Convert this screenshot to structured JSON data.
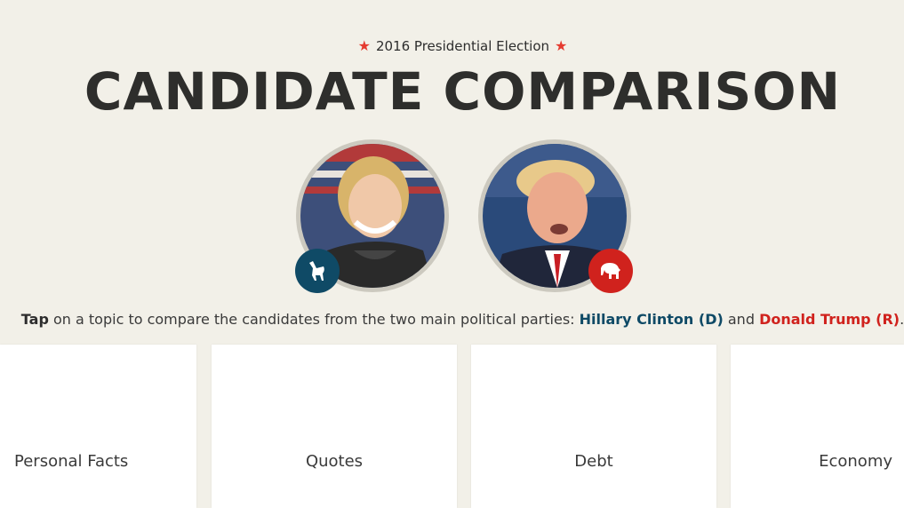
{
  "header": {
    "kicker": "2016 Presidential Election",
    "title": "CANDIDATE COMPARISON"
  },
  "candidates": [
    {
      "name": "Hillary Clinton (D)",
      "party": "Democratic",
      "party_icon": "donkey-icon",
      "color": "#0f4a66"
    },
    {
      "name": "Donald Trump (R)",
      "party": "Republican",
      "party_icon": "elephant-icon",
      "color": "#d0221d"
    }
  ],
  "instructions": {
    "tap": "Tap",
    "middle": " on a topic to compare the candidates from the two main political parties: ",
    "and": " and ",
    "end": "."
  },
  "topics": [
    {
      "label": "Personal Facts"
    },
    {
      "label": "Quotes"
    },
    {
      "label": "Debt"
    },
    {
      "label": "Economy"
    }
  ],
  "colors": {
    "background": "#f2f0e8",
    "accent_star": "#e53a2f",
    "democrat": "#0f4a66",
    "republican": "#d0221d"
  }
}
